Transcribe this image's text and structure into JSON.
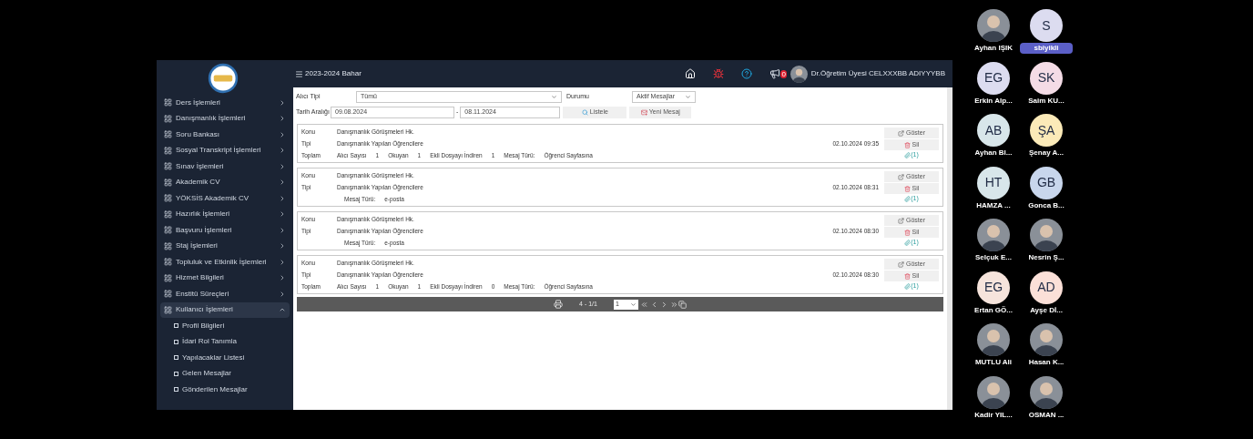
{
  "topbar": {
    "term": "2023-2024 Bahar",
    "notification_count": "0",
    "user": "Dr.Öğretim Üyesi CELXXXBB ADIYYYBB"
  },
  "sidebar": {
    "items": [
      {
        "label": "Ders İşlemleri",
        "expanded": false
      },
      {
        "label": "Danışmanlık İşlemleri",
        "expanded": false
      },
      {
        "label": "Soru Bankası",
        "expanded": false
      },
      {
        "label": "Sosyal Transkript İşlemleri",
        "expanded": false
      },
      {
        "label": "Sınav İşlemleri",
        "expanded": false
      },
      {
        "label": "Akademik CV",
        "expanded": false
      },
      {
        "label": "YÖKSİS Akademik CV",
        "expanded": false
      },
      {
        "label": "Hazırlık İşlemleri",
        "expanded": false
      },
      {
        "label": "Başvuru İşlemleri",
        "expanded": false
      },
      {
        "label": "Staj İşlemleri",
        "expanded": false
      },
      {
        "label": "Topluluk ve Etkinlik İşlemleri",
        "expanded": false
      },
      {
        "label": "Hizmet Bilgileri",
        "expanded": false
      },
      {
        "label": "Enstitü Süreçleri",
        "expanded": false
      },
      {
        "label": "Kullanıcı İşlemleri",
        "expanded": true,
        "children": [
          "Profil Bilgileri",
          "İdari Rol Tanımla",
          "Yapılacaklar Listesi",
          "Gelen Mesajlar",
          "Gönderilen Mesajlar"
        ]
      }
    ]
  },
  "filters": {
    "recipient_label": "Alıcı Tipi",
    "recipient_value": "Tümü",
    "status_label": "Durumu",
    "status_value": "Aktif Mesajlar",
    "date_label": "Tarih Aralığı",
    "date_from": "09.08.2024",
    "date_separator": "-",
    "date_to": "08.11.2024",
    "list_button": "Listele",
    "new_button": "Yeni Mesaj"
  },
  "messages": [
    {
      "subject_label": "Konu",
      "subject": "Danışmanlık Görüşmeleri Hk.",
      "type_label": "Tipi",
      "type": "Danışmanlık Yapılan Öğrencilere",
      "date": "02.10.2024 09:35",
      "show": "Göster",
      "delete": "Sil",
      "attachments": "(1)",
      "footer_label": "Toplam",
      "stats": [
        {
          "label": "Alıcı Sayısı",
          "value": "1"
        },
        {
          "label": "Okuyan",
          "value": "1"
        },
        {
          "label": "Ekli Dosyayı İndiren",
          "value": "1"
        },
        {
          "label": "Mesaj Türü:",
          "value": "Öğrenci Sayfasına"
        }
      ]
    },
    {
      "subject_label": "Konu",
      "subject": "Danışmanlık Görüşmeleri Hk.",
      "type_label": "Tipi",
      "type": "Danışmanlık Yapılan Öğrencilere",
      "date": "02.10.2024 08:31",
      "show": "Göster",
      "delete": "Sil",
      "attachments": "(1)",
      "stats": [
        {
          "label": "Mesaj Türü:",
          "value": "e-posta"
        }
      ]
    },
    {
      "subject_label": "Konu",
      "subject": "Danışmanlık Görüşmeleri Hk.",
      "type_label": "Tipi",
      "type": "Danışmanlık Yapılan Öğrencilere",
      "date": "02.10.2024 08:30",
      "show": "Göster",
      "delete": "Sil",
      "attachments": "(1)",
      "stats": [
        {
          "label": "Mesaj Türü:",
          "value": "e-posta"
        }
      ]
    },
    {
      "subject_label": "Konu",
      "subject": "Danışmanlık Görüşmeleri Hk.",
      "type_label": "Tipi",
      "type": "Danışmanlık Yapılan Öğrencilere",
      "date": "02.10.2024 08:30",
      "show": "Göster",
      "delete": "Sil",
      "attachments": "(1)",
      "footer_label": "Toplam",
      "stats": [
        {
          "label": "Alıcı Sayısı",
          "value": "1"
        },
        {
          "label": "Okuyan",
          "value": "1"
        },
        {
          "label": "Ekli Dosyayı İndiren",
          "value": "0"
        },
        {
          "label": "Mesaj Türü:",
          "value": "Öğrenci Sayfasına"
        }
      ]
    }
  ],
  "pager": {
    "range": "4 - 1/1",
    "page": "1"
  },
  "participant_rows": [
    [
      {
        "name": "Ayhan IŞIK",
        "kind": "photo",
        "highlighted": false
      },
      {
        "name": "sbiyikli",
        "kind": "initials",
        "initials": "S",
        "color": "#dcdcf0",
        "highlighted": true
      }
    ],
    [
      {
        "name": "Erkin Alp...",
        "kind": "initials",
        "initials": "EG",
        "color": "#dcdcf0",
        "highlighted": false
      },
      {
        "name": "Saim KU...",
        "kind": "initials",
        "initials": "SK",
        "color": "#f4dce6",
        "highlighted": false
      }
    ],
    [
      {
        "name": "Ayhan Bl...",
        "kind": "initials",
        "initials": "AB",
        "color": "#d8e6ea",
        "highlighted": false
      },
      {
        "name": "Şenay A...",
        "kind": "initials",
        "initials": "ŞA",
        "color": "#fbeab8",
        "highlighted": false
      }
    ],
    [
      {
        "name": "HAMZA ...",
        "kind": "initials",
        "initials": "HT",
        "color": "#d8e6ea",
        "highlighted": false
      },
      {
        "name": "Gonca B...",
        "kind": "initials",
        "initials": "GB",
        "color": "#c8d6ec",
        "highlighted": false
      }
    ],
    [
      {
        "name": "Selçuk E...",
        "kind": "photo",
        "highlighted": false
      },
      {
        "name": "Nesrin Ş...",
        "kind": "photo",
        "highlighted": false
      }
    ],
    [
      {
        "name": "Ertan GÖ...",
        "kind": "initials",
        "initials": "EG",
        "color": "#f6e4dc",
        "highlighted": false
      },
      {
        "name": "Ayşe Dİ...",
        "kind": "initials",
        "initials": "AD",
        "color": "#fbe0d8",
        "highlighted": false
      }
    ],
    [
      {
        "name": "MUTLU Ali",
        "kind": "photo",
        "highlighted": false
      },
      {
        "name": "Hasan K...",
        "kind": "photo",
        "highlighted": false
      }
    ],
    [
      {
        "name": "Kadir YIL...",
        "kind": "photo",
        "highlighted": false
      },
      {
        "name": "OSMAN ...",
        "kind": "photo",
        "highlighted": false
      }
    ]
  ]
}
